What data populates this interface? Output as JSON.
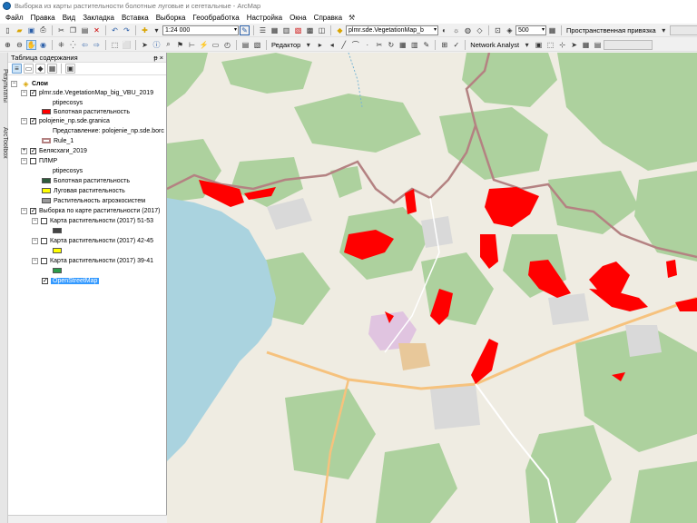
{
  "window": {
    "title": "Выборка из карты растительности болотные луговые и сегетальные - ArcMap"
  },
  "menu": [
    "Файл",
    "Правка",
    "Вид",
    "Закладка",
    "Вставка",
    "Выборка",
    "Геообработка",
    "Настройка",
    "Окна",
    "Справка"
  ],
  "toolbar1": {
    "scale": "1:24 000",
    "layer_combo": "plmr.sde.VegetationMap_b",
    "count": "500",
    "georef": "Пространственная привязка"
  },
  "toolbar2": {
    "editor": "Редактор",
    "network": "Network Analyst"
  },
  "side_tabs": [
    "Результаты",
    "ArcToolbox"
  ],
  "toc": {
    "title": "Таблица содержания",
    "pin": "ᵽ ×",
    "layers_root": "Слои",
    "items": [
      {
        "label": "plmr.sde.VegetationMap_big_VBU_2019"
      },
      {
        "label": "ptipecosys"
      },
      {
        "label": "Болотная растительность"
      },
      {
        "label": "polojenie_np.sde.granica"
      },
      {
        "label": "Представление: polojenie_np.sde.borc"
      },
      {
        "label": "Rule_1"
      },
      {
        "label": "Белясхаги_2019"
      },
      {
        "label": "ПЛМР"
      },
      {
        "label": "ptipecosys"
      },
      {
        "label": "Болотная растительность"
      },
      {
        "label": "Луговая растительность"
      },
      {
        "label": "Растительность агроэкосистем"
      },
      {
        "label": "Выборка по карте растительности (2017)"
      },
      {
        "label": "Карта растительности (2017) 51-53"
      },
      {
        "label": "Карта растительности (2017) 42-45"
      },
      {
        "label": "Карта растительности (2017) 39-41"
      },
      {
        "label": "OpenStreetMap"
      }
    ]
  },
  "colors": {
    "wetland": "#ff0000",
    "forest": "#add19e",
    "land": "#efece2",
    "water": "#aad3df",
    "boundary": "#b48282",
    "road": "#f6c27d",
    "swatch_dark_green": "#2e5c3c",
    "swatch_yellow": "#ffff00",
    "swatch_gray": "#999999",
    "swatch_green_2": "#2a9d4a"
  }
}
